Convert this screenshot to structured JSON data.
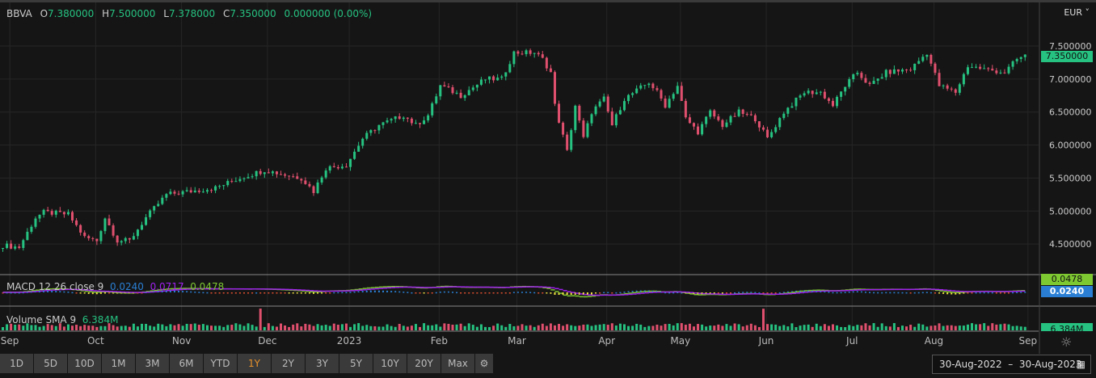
{
  "header": {
    "symbol": "BBVA",
    "o_label": "O",
    "open": "7.380000",
    "h_label": "H",
    "high": "7.500000",
    "l_label": "L",
    "low": "7.378000",
    "c_label": "C",
    "close": "7.350000",
    "change": "0.000000 (0.00%)",
    "currency": "EUR"
  },
  "macd": {
    "label": "MACD 12 26 close 9",
    "macd": "0.0240",
    "signal": "0.0717",
    "hist": "0.0478",
    "tag_hist": "0.0478",
    "tag_macd": "0.0240"
  },
  "volume": {
    "label": "Volume SMA 9",
    "value": "6.384M",
    "tag": "6.384M"
  },
  "price_tag": "7.350000",
  "range_buttons": [
    "1D",
    "5D",
    "10D",
    "1M",
    "3M",
    "6M",
    "YTD",
    "1Y",
    "2Y",
    "3Y",
    "5Y",
    "10Y",
    "20Y",
    "Max"
  ],
  "active_range": "1Y",
  "date_range": "30-Aug-2022  –  30-Aug-2023",
  "colors": {
    "up": "#26c281",
    "down": "#e0506e",
    "macd": "#2a7fd4",
    "signal": "#a020f0",
    "hist_line": "#7ec832"
  },
  "chart_data": {
    "type": "candlestick",
    "title": "BBVA",
    "ylabel": "EUR",
    "ylim": [
      4.2,
      7.7
    ],
    "yticks": [
      "7.500000",
      "7.000000",
      "6.500000",
      "6.000000",
      "5.500000",
      "5.000000",
      "4.500000"
    ],
    "ytick_values": [
      7.5,
      7.0,
      6.5,
      6.0,
      5.5,
      5.0,
      4.5
    ],
    "xticks": [
      "Sep",
      "Oct",
      "Nov",
      "Dec",
      "2023",
      "Feb",
      "Mar",
      "Apr",
      "May",
      "Jun",
      "Jul",
      "Aug",
      "Sep"
    ],
    "xtick_days": [
      2,
      23,
      44,
      65,
      85,
      107,
      126,
      148,
      166,
      187,
      208,
      228,
      251
    ],
    "days": 254,
    "close_keypoints": [
      [
        0,
        4.48
      ],
      [
        4,
        4.45
      ],
      [
        8,
        4.9
      ],
      [
        10,
        4.98
      ],
      [
        16,
        4.95
      ],
      [
        20,
        4.6
      ],
      [
        23,
        4.55
      ],
      [
        25,
        4.9
      ],
      [
        28,
        4.55
      ],
      [
        31,
        4.55
      ],
      [
        35,
        4.9
      ],
      [
        40,
        5.25
      ],
      [
        46,
        5.3
      ],
      [
        52,
        5.35
      ],
      [
        58,
        5.5
      ],
      [
        64,
        5.62
      ],
      [
        69,
        5.55
      ],
      [
        73,
        5.5
      ],
      [
        76,
        5.3
      ],
      [
        79,
        5.65
      ],
      [
        84,
        5.7
      ],
      [
        88,
        6.1
      ],
      [
        92,
        6.3
      ],
      [
        98,
        6.45
      ],
      [
        101,
        6.3
      ],
      [
        104,
        6.45
      ],
      [
        107,
        6.9
      ],
      [
        112,
        6.75
      ],
      [
        118,
        7.0
      ],
      [
        122,
        7.0
      ],
      [
        125,
        7.4
      ],
      [
        130,
        7.4
      ],
      [
        132,
        7.3
      ],
      [
        134,
        7.1
      ],
      [
        135,
        6.6
      ],
      [
        138,
        5.9
      ],
      [
        140,
        6.6
      ],
      [
        142,
        6.1
      ],
      [
        144,
        6.5
      ],
      [
        147,
        6.7
      ],
      [
        149,
        6.3
      ],
      [
        152,
        6.7
      ],
      [
        158,
        6.95
      ],
      [
        160,
        6.8
      ],
      [
        162,
        6.6
      ],
      [
        165,
        6.9
      ],
      [
        167,
        6.4
      ],
      [
        170,
        6.2
      ],
      [
        173,
        6.5
      ],
      [
        176,
        6.3
      ],
      [
        180,
        6.5
      ],
      [
        184,
        6.4
      ],
      [
        187,
        6.1
      ],
      [
        191,
        6.5
      ],
      [
        196,
        6.8
      ],
      [
        200,
        6.8
      ],
      [
        203,
        6.6
      ],
      [
        206,
        6.9
      ],
      [
        209,
        7.1
      ],
      [
        212,
        6.9
      ],
      [
        216,
        7.1
      ],
      [
        222,
        7.15
      ],
      [
        226,
        7.4
      ],
      [
        229,
        6.9
      ],
      [
        233,
        6.8
      ],
      [
        236,
        7.2
      ],
      [
        240,
        7.15
      ],
      [
        245,
        7.1
      ],
      [
        248,
        7.3
      ],
      [
        250,
        7.35
      ]
    ]
  }
}
